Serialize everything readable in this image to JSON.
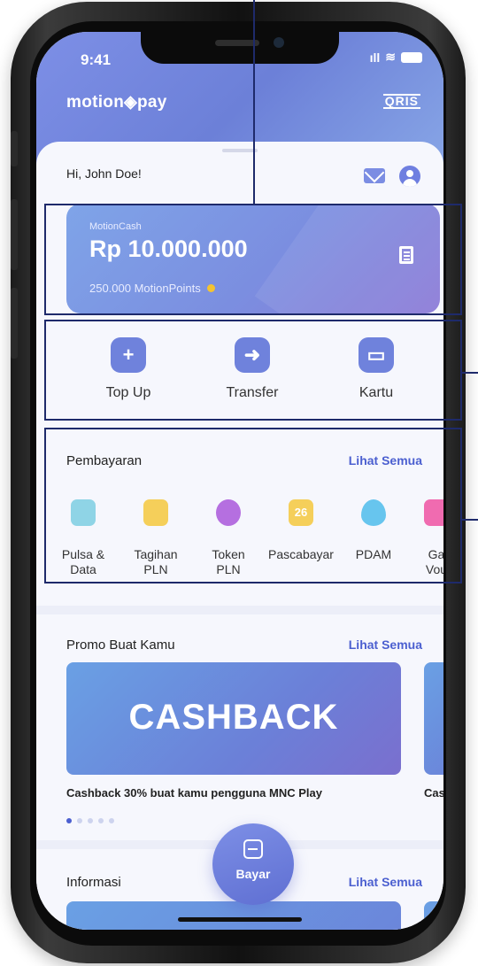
{
  "status_bar": {
    "time": "9:41",
    "signal": "ıll",
    "wifi": "≋"
  },
  "header": {
    "brand": "motion◈pay",
    "qris": "QRIS"
  },
  "greeting": "Hi, John Doe!",
  "wallet": {
    "label": "MotionCash",
    "balance": "Rp 10.000.000",
    "points": "250.000 MotionPoints"
  },
  "actions": [
    {
      "label": "Top Up",
      "icon": "plus-icon",
      "glyph": "+"
    },
    {
      "label": "Transfer",
      "icon": "arrow-right-icon",
      "glyph": "➜"
    },
    {
      "label": "Kartu",
      "icon": "card-icon",
      "glyph": "▭"
    }
  ],
  "payments": {
    "title": "Pembayaran",
    "see_all": "Lihat Semua",
    "items": [
      {
        "label_1": "Pulsa &",
        "label_2": "Data",
        "icon": "phone-icon",
        "color": "#8fd4e6"
      },
      {
        "label_1": "Tagihan",
        "label_2": "PLN",
        "icon": "bill-icon",
        "color": "#f5cf5a"
      },
      {
        "label_1": "Token",
        "label_2": "PLN",
        "icon": "token-icon",
        "color": "#b56fe0"
      },
      {
        "label_1": "Pascabayar",
        "label_2": "",
        "icon": "calendar-icon",
        "color": "#f5cf5a",
        "badge": "26"
      },
      {
        "label_1": "PDAM",
        "label_2": "",
        "icon": "water-drop-icon",
        "color": "#67c5ee"
      },
      {
        "label_1": "Ga",
        "label_2": "Vou",
        "icon": "voucher-icon",
        "color": "#f06bb0"
      }
    ]
  },
  "promo": {
    "title": "Promo Buat Kamu",
    "see_all": "Lihat Semua",
    "banner_text": "CASHBACK",
    "caption": "Cashback 30% buat kamu pengguna MNC Play",
    "caption_next": "Cashb",
    "dots_count": 5,
    "active_dot": 1
  },
  "info": {
    "title": "Informasi",
    "see_all": "Lihat Semua"
  },
  "pay_button": {
    "label": "Bayar"
  },
  "colors": {
    "primary": "#6f82dc",
    "link": "#4b5fd0",
    "annotation": "#1e2a6b"
  }
}
